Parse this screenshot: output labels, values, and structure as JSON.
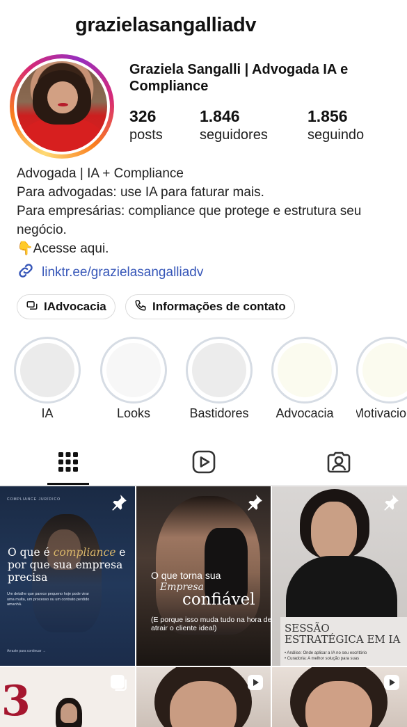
{
  "profile": {
    "username": "grazielasangalliadv",
    "display_name": "Graziela Sangalli | Advogada IA e Compliance",
    "stats": {
      "posts": {
        "value": "326",
        "label": "posts"
      },
      "followers": {
        "value": "1.846",
        "label": "seguidores"
      },
      "following": {
        "value": "1.856",
        "label": "seguindo"
      }
    },
    "bio": [
      "Advogada | IA + Compliance",
      "Para advogadas: use IA para faturar mais.",
      "Para empresárias: compliance que protege e estrutura seu negócio.",
      "👇Acesse aqui."
    ],
    "link": "linktr.ee/grazielasangalliadv",
    "ring_colors": [
      "#feda75",
      "#fa7e1e",
      "#d62976",
      "#962fbf"
    ]
  },
  "buttons": {
    "threads_label": "IAdvocacia",
    "contact_label": "Informações de contato"
  },
  "highlights": [
    {
      "label": "IA",
      "color": "#ebebeb"
    },
    {
      "label": "Looks",
      "color": "#f7f7f7"
    },
    {
      "label": "Bastidores",
      "color": "#ececec"
    },
    {
      "label": "Advocacia",
      "color": "#fbfbef"
    },
    {
      "label": "Motivacio",
      "color": "#fbfbef"
    }
  ],
  "tabs": {
    "grid_icon": "grid-icon",
    "reels_icon": "reels-icon",
    "tagged_icon": "tagged-icon",
    "active": "grid"
  },
  "posts": [
    {
      "type": "pinned",
      "small": "COMPLIANCE JURÍDICO",
      "headline_pre": "O que é ",
      "headline_em": "compliance",
      "headline_post": " e por que sua empresa precisa",
      "sub": "Um detalhe que parece pequeno hoje pode virar uma multa, um processo ou um contrato perdido amanhã.",
      "cta": "Arraste para continuar →"
    },
    {
      "type": "pinned",
      "line1": "O que torna sua",
      "line2": "Empresa",
      "line3": "confiável",
      "sub": "(E porque isso muda tudo na hora de atrair o cliente ideal)"
    },
    {
      "type": "pinned",
      "title": "SESSÃO ESTRATÉGICA EM IA",
      "bullets": [
        "• Análise: Onde aplicar a IA no seu escritório",
        "• Curadoria: A melhor solução para suas"
      ]
    },
    {
      "type": "carousel",
      "number": "3"
    },
    {
      "type": "reel"
    },
    {
      "type": "reel"
    }
  ]
}
